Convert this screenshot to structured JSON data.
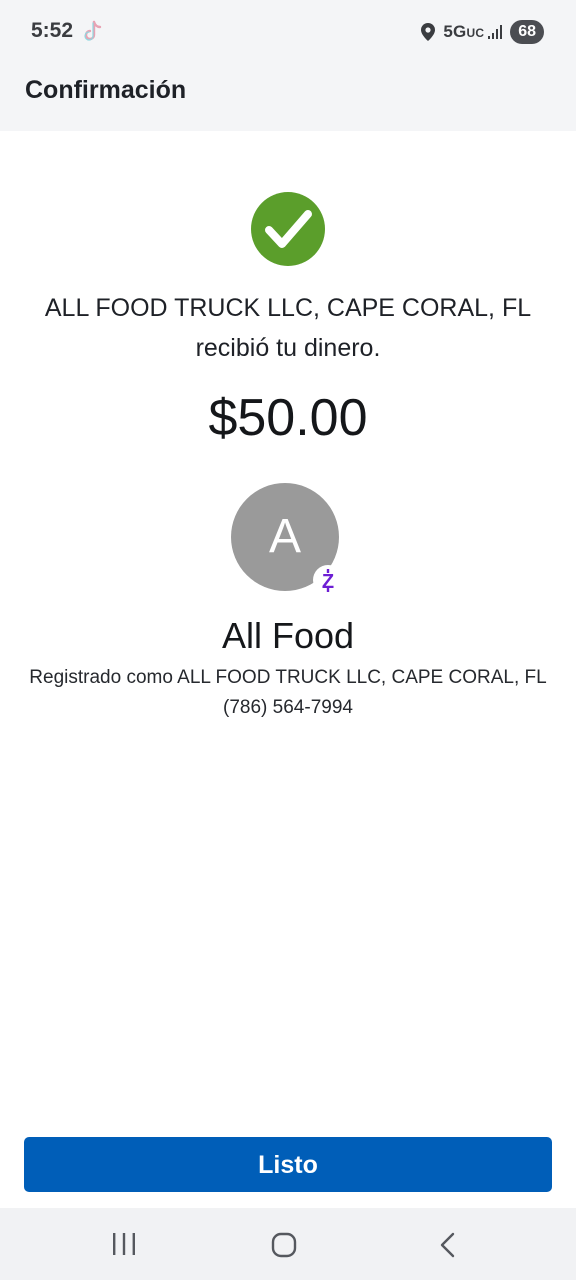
{
  "status_bar": {
    "time": "5:52",
    "network": "5G",
    "network_suffix": "UC",
    "battery": "68",
    "icons": [
      "tiktok-icon",
      "location-icon",
      "signal-icon"
    ]
  },
  "header": {
    "title": "Confirmación"
  },
  "confirmation": {
    "icon": "check-circle-icon",
    "accent_color": "#5b9e2b",
    "message_line1": "ALL FOOD TRUCK LLC, CAPE CORAL, FL",
    "message_line2": "recibió tu dinero.",
    "amount": "$50.00"
  },
  "recipient": {
    "avatar_letter": "A",
    "badge_icon": "zelle-icon",
    "badge_color": "#6d1ed4",
    "name": "All Food",
    "registered_as": "Registrado como ALL FOOD TRUCK LLC, CAPE CORAL, FL",
    "phone": "(786) 564-7994"
  },
  "actions": {
    "done_label": "Listo",
    "button_color": "#005eb8"
  },
  "nav_bar": {
    "icons": [
      "recents-icon",
      "home-icon",
      "back-icon"
    ]
  }
}
